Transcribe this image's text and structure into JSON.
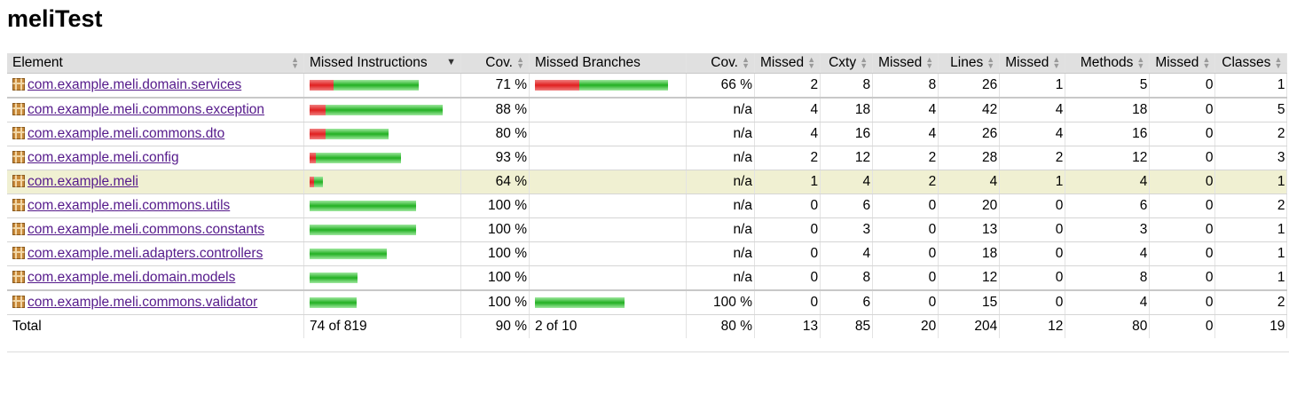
{
  "title": "meliTest",
  "headers": {
    "element": "Element",
    "missed_instructions": "Missed Instructions",
    "cov1": "Cov.",
    "missed_branches": "Missed Branches",
    "cov2": "Cov.",
    "missed_cxty": "Missed",
    "cxty": "Cxty",
    "missed_lines": "Missed",
    "lines": "Lines",
    "missed_methods": "Missed",
    "methods": "Methods",
    "missed_classes": "Missed",
    "classes": "Classes"
  },
  "rows": [
    {
      "name": "com.example.meli.domain.services",
      "instr_red": 0.22,
      "instr_green": 0.78,
      "instr_total": 0.82,
      "cov1": "71 %",
      "br_red": 0.33,
      "br_green": 0.67,
      "br_total": 1.0,
      "cov2": "66 %",
      "mcx": "2",
      "cx": "8",
      "mln": "8",
      "ln": "26",
      "mmt": "1",
      "mt": "5",
      "mcl": "0",
      "cl": "1"
    },
    {
      "name": "com.example.meli.commons.exception",
      "instr_red": 0.12,
      "instr_green": 0.88,
      "instr_total": 1.0,
      "cov1": "88 %",
      "br_red": 0,
      "br_green": 0,
      "br_total": 0,
      "cov2": "n/a",
      "mcx": "4",
      "cx": "18",
      "mln": "4",
      "ln": "42",
      "mmt": "4",
      "mt": "18",
      "mcl": "0",
      "cl": "5"
    },
    {
      "name": "com.example.meli.commons.dto",
      "instr_red": 0.2,
      "instr_green": 0.8,
      "instr_total": 0.59,
      "cov1": "80 %",
      "br_red": 0,
      "br_green": 0,
      "br_total": 0,
      "cov2": "n/a",
      "mcx": "4",
      "cx": "16",
      "mln": "4",
      "ln": "26",
      "mmt": "4",
      "mt": "16",
      "mcl": "0",
      "cl": "2"
    },
    {
      "name": "com.example.meli.config",
      "instr_red": 0.07,
      "instr_green": 0.93,
      "instr_total": 0.69,
      "cov1": "93 %",
      "br_red": 0,
      "br_green": 0,
      "br_total": 0,
      "cov2": "n/a",
      "mcx": "2",
      "cx": "12",
      "mln": "2",
      "ln": "28",
      "mmt": "2",
      "mt": "12",
      "mcl": "0",
      "cl": "3"
    },
    {
      "name": "com.example.meli",
      "instr_red": 0.36,
      "instr_green": 0.64,
      "instr_total": 0.1,
      "cov1": "64 %",
      "br_red": 0,
      "br_green": 0,
      "br_total": 0,
      "cov2": "n/a",
      "mcx": "1",
      "cx": "4",
      "mln": "2",
      "ln": "4",
      "mmt": "1",
      "mt": "4",
      "mcl": "0",
      "cl": "1"
    },
    {
      "name": "com.example.meli.commons.utils",
      "instr_red": 0,
      "instr_green": 1.0,
      "instr_total": 0.8,
      "cov1": "100 %",
      "br_red": 0,
      "br_green": 0,
      "br_total": 0,
      "cov2": "n/a",
      "mcx": "0",
      "cx": "6",
      "mln": "0",
      "ln": "20",
      "mmt": "0",
      "mt": "6",
      "mcl": "0",
      "cl": "2"
    },
    {
      "name": "com.example.meli.commons.constants",
      "instr_red": 0,
      "instr_green": 1.0,
      "instr_total": 0.8,
      "cov1": "100 %",
      "br_red": 0,
      "br_green": 0,
      "br_total": 0,
      "cov2": "n/a",
      "mcx": "0",
      "cx": "3",
      "mln": "0",
      "ln": "13",
      "mmt": "0",
      "mt": "3",
      "mcl": "0",
      "cl": "1"
    },
    {
      "name": "com.example.meli.adapters.controllers",
      "instr_red": 0,
      "instr_green": 1.0,
      "instr_total": 0.58,
      "cov1": "100 %",
      "br_red": 0,
      "br_green": 0,
      "br_total": 0,
      "cov2": "n/a",
      "mcx": "0",
      "cx": "4",
      "mln": "0",
      "ln": "18",
      "mmt": "0",
      "mt": "4",
      "mcl": "0",
      "cl": "1"
    },
    {
      "name": "com.example.meli.domain.models",
      "instr_red": 0,
      "instr_green": 1.0,
      "instr_total": 0.36,
      "cov1": "100 %",
      "br_red": 0,
      "br_green": 0,
      "br_total": 0,
      "cov2": "n/a",
      "mcx": "0",
      "cx": "8",
      "mln": "0",
      "ln": "12",
      "mmt": "0",
      "mt": "8",
      "mcl": "0",
      "cl": "1"
    },
    {
      "name": "com.example.meli.commons.validator",
      "instr_red": 0,
      "instr_green": 1.0,
      "instr_total": 0.35,
      "cov1": "100 %",
      "br_red": 0,
      "br_green": 1.0,
      "br_total": 0.67,
      "cov2": "100 %",
      "mcx": "0",
      "cx": "6",
      "mln": "0",
      "ln": "15",
      "mmt": "0",
      "mt": "4",
      "mcl": "0",
      "cl": "2"
    }
  ],
  "total": {
    "label": "Total",
    "instr": "74 of 819",
    "cov1": "90 %",
    "br": "2 of 10",
    "cov2": "80 %",
    "mcx": "13",
    "cx": "85",
    "mln": "20",
    "ln": "204",
    "mmt": "12",
    "mt": "80",
    "mcl": "0",
    "cl": "19"
  },
  "colors": {
    "missed": "#e02020",
    "covered": "#22b022",
    "highlight_row": "#f0f0d2",
    "header_bg": "#e0e0e0",
    "link": "#551a8b"
  }
}
